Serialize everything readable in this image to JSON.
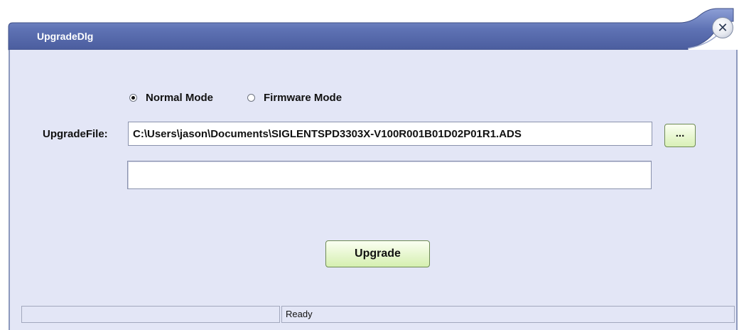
{
  "window": {
    "title": "UpgradeDlg",
    "close_icon": "close-x-icon",
    "close_glyph": "✕"
  },
  "mode": {
    "options": [
      {
        "label": "Normal Mode",
        "selected": true
      },
      {
        "label": "Firmware Mode",
        "selected": false
      }
    ]
  },
  "file": {
    "label": "UpgradeFile:",
    "value": "C:\\Users\\jason\\Documents\\SIGLENTSPD3303X-V100R001B01D02P01R1.ADS",
    "browse_label": "..."
  },
  "progress": {
    "percent": 0
  },
  "actions": {
    "upgrade_label": "Upgrade"
  },
  "status": {
    "left": "",
    "right": "Ready"
  },
  "colors": {
    "title_bar": "#5b6eaf",
    "client_bg": "#e3e6f6",
    "button_green": "#d5efb0"
  }
}
